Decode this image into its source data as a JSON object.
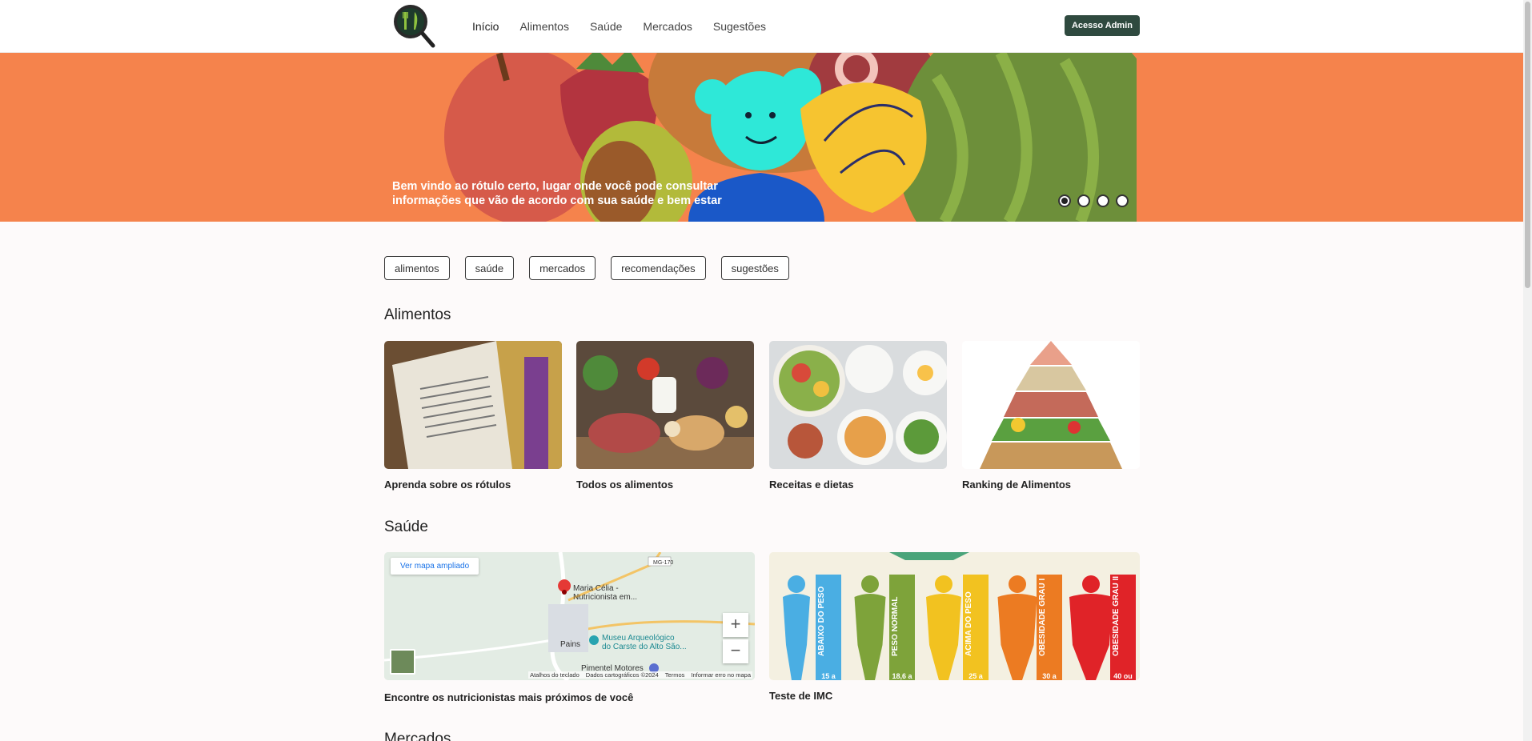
{
  "nav": {
    "links": [
      "Início",
      "Alimentos",
      "Saúde",
      "Mercados",
      "Sugestões"
    ],
    "admin_label": "Acesso Admin"
  },
  "hero": {
    "caption_line1": "Bem vindo ao rótulo certo, lugar onde você pode consultar",
    "caption_line2": "informações que vão de acordo com sua saúde e bem estar",
    "slides": 4,
    "active_slide": 1
  },
  "chips": [
    "alimentos",
    "saúde",
    "mercados",
    "recomendações",
    "sugestões"
  ],
  "alimentos": {
    "title": "Alimentos",
    "cards": [
      "Aprenda sobre os rótulos",
      "Todos os alimentos",
      "Receitas e dietas",
      "Ranking de Alimentos"
    ]
  },
  "saude": {
    "title": "Saúde",
    "map_card_label": "Encontre os nutricionistas mais próximos de você",
    "imc_card_label": "Teste de IMC",
    "map": {
      "open_label": "Ver mapa ampliado",
      "place1_line1": "Maria Célia -",
      "place1_line2": "Nutricionista em...",
      "place2_line1": "Museu Arqueológico",
      "place2_line2": "do Carste do Alto São...",
      "town": "Pains",
      "road": "MG-170",
      "poi": "Pimentel Motores",
      "footer": [
        "Atalhos do teclado",
        "Dados cartográficos ©2024",
        "Termos",
        "Informar erro no mapa"
      ]
    },
    "imc": {
      "labels": [
        "ABAIXO DO PESO",
        "PESO NORMAL",
        "ACIMA DO PESO",
        "OBESIDADE GRAU I",
        "OBESIDADE GRAU II"
      ],
      "values": [
        "15 a",
        "18,6 a",
        "25 a",
        "30 a",
        "40 ou"
      ],
      "colors": [
        "#4aaee3",
        "#7ea33a",
        "#f2c220",
        "#ec7b22",
        "#e02328"
      ]
    }
  },
  "mercados": {
    "title": "Mercados"
  }
}
